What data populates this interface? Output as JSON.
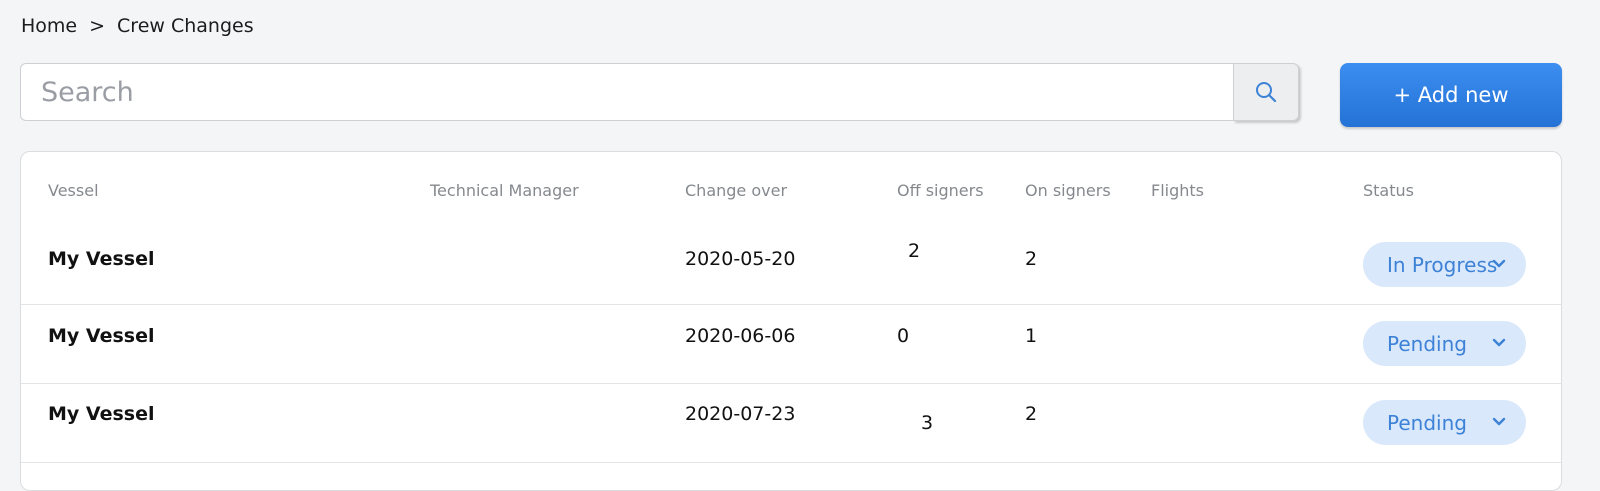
{
  "breadcrumb": {
    "home": "Home",
    "separator": ">",
    "current": "Crew Changes"
  },
  "search": {
    "placeholder": "Search",
    "value": ""
  },
  "toolbar": {
    "add_label": "+ Add new"
  },
  "table": {
    "headers": {
      "vessel": "Vessel",
      "technical_manager": "Technical Manager",
      "change_over": "Change over",
      "off_signers": "Off signers",
      "on_signers": "On signers",
      "flights": "Flights",
      "status": "Status"
    },
    "rows": [
      {
        "vessel": "My Vessel",
        "technical_manager": "",
        "change_over": "2020-05-20",
        "off_signers": "2",
        "on_signers": "2",
        "flights": "",
        "status": "In Progress"
      },
      {
        "vessel": "My Vessel",
        "technical_manager": "",
        "change_over": "2020-06-06",
        "off_signers": "0",
        "on_signers": "1",
        "flights": "",
        "status": "Pending"
      },
      {
        "vessel": "My Vessel",
        "technical_manager": "",
        "change_over": "2020-07-23",
        "off_signers": "3",
        "on_signers": "2",
        "flights": "",
        "status": "Pending"
      }
    ]
  },
  "colors": {
    "accent": "#2f80e6",
    "status_bg": "#d9e8fb",
    "status_text": "#3d82d6"
  },
  "icons": {
    "search": "search-icon",
    "status_dropdown": "chevron-down-icon"
  }
}
